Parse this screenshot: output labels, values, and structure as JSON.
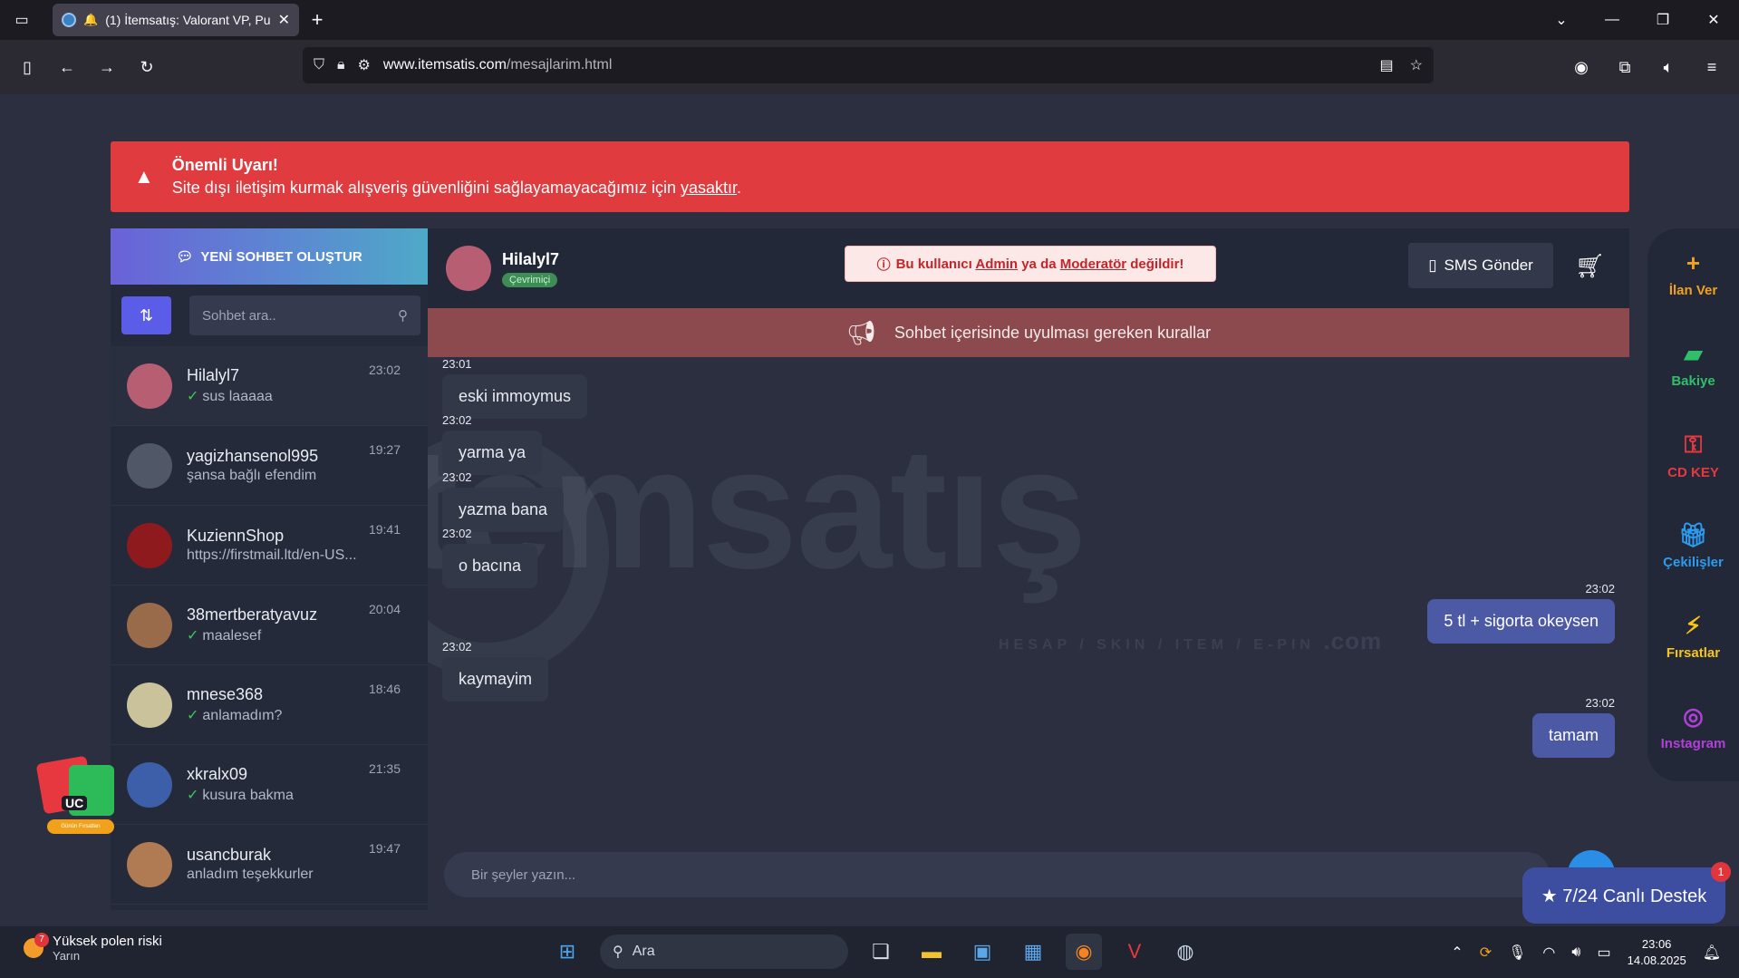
{
  "browser": {
    "tab_title": "(1) İtemsatış: Valorant VP, Pu",
    "url_host": "www.itemsatis.com",
    "url_path": "/mesajlarim.html"
  },
  "warning": {
    "title": "Önemli Uyarı!",
    "text_before": "Site dışı iletişim kurmak alışveriş güvenliğini sağlayamayacağımız için ",
    "link": "yasaktır",
    "text_after": "."
  },
  "sidebar": {
    "new_chat_label": "YENİ SOHBET OLUŞTUR",
    "search_placeholder": "Sohbet ara..",
    "conversations": [
      {
        "name": "Hilalyl7",
        "msg": "sus laaaaa",
        "time": "23:02",
        "read": true,
        "avatar_color": "#b85e72"
      },
      {
        "name": "yagizhansenol995",
        "msg": "şansa bağlı efendim",
        "time": "19:27",
        "read": false,
        "avatar_color": "#505868"
      },
      {
        "name": "KuziennShop",
        "msg": "https://firstmail.ltd/en-US...",
        "time": "19:41",
        "read": false,
        "avatar_color": "#8e1a1e"
      },
      {
        "name": "38mertberatyavuz",
        "msg": "maalesef",
        "time": "20:04",
        "read": true,
        "avatar_color": "#9a6b4a"
      },
      {
        "name": "mnese368",
        "msg": "anlamadım?",
        "time": "18:46",
        "read": true,
        "avatar_color": "#c9c29a"
      },
      {
        "name": "xkralx09",
        "msg": "kusura bakma",
        "time": "21:35",
        "read": true,
        "avatar_color": "#3d5ea8"
      },
      {
        "name": "usancburak",
        "msg": "anladım teşekkurler",
        "time": "19:47",
        "read": false,
        "avatar_color": "#b07a52"
      }
    ]
  },
  "chat": {
    "user": "Hilalyl7",
    "status": "Çevrimiçi",
    "admin_note_before": "Bu kullanıcı ",
    "admin_note_admin": "Admin",
    "admin_note_mid": " ya da ",
    "admin_note_mod": "Moderatör",
    "admin_note_after": " değildir!",
    "sms_label": "SMS Gönder",
    "rules_label": "Sohbet içerisinde uyulması gereken kurallar",
    "watermark": "itemsatış",
    "watermark_sub": "HESAP / SKIN / ITEM / E-PIN",
    "watermark_com": ".com",
    "messages": [
      {
        "time": "23:01",
        "text": "eski immoymus",
        "me": false
      },
      {
        "time": "23:02",
        "text": "yarma ya",
        "me": false
      },
      {
        "time": "23:02",
        "text": "yazma bana",
        "me": false
      },
      {
        "time": "23:02",
        "text": "o bacına",
        "me": false
      },
      {
        "time": "23:02",
        "text": "5 tl + sigorta okeysen",
        "me": true
      },
      {
        "time": "23:02",
        "text": "kaymayim",
        "me": false
      },
      {
        "time": "23:02",
        "text": "tamam",
        "me": true
      }
    ],
    "composer_placeholder": "Bir şeyler yazın..."
  },
  "side_menu": [
    {
      "label": "İlan Ver",
      "icon": "plus-icon",
      "color": "#f2a11c"
    },
    {
      "label": "Bakiye",
      "icon": "wallet-icon",
      "color": "#2fbf6a"
    },
    {
      "label": "CD KEY",
      "icon": "key-icon",
      "color": "#e8383f"
    },
    {
      "label": "Çekilişler",
      "icon": "gift-icon",
      "color": "#2a9cf0"
    },
    {
      "label": "Fırsatlar",
      "icon": "bolt-icon",
      "color": "#f5c518"
    },
    {
      "label": "Instagram",
      "icon": "instagram-icon",
      "color": "#b040d8"
    }
  ],
  "support": {
    "label": "★ 7/24 Canlı Destek",
    "badge": "1"
  },
  "promo": {
    "uc": "UC",
    "ribbon": "Günün Fırsatları"
  },
  "taskbar": {
    "weather_badge": "7",
    "weather_title": "Yüksek polen riski",
    "weather_sub": "Yarın",
    "search_label": "Ara",
    "time": "23:06",
    "date": "14.08.2025"
  }
}
